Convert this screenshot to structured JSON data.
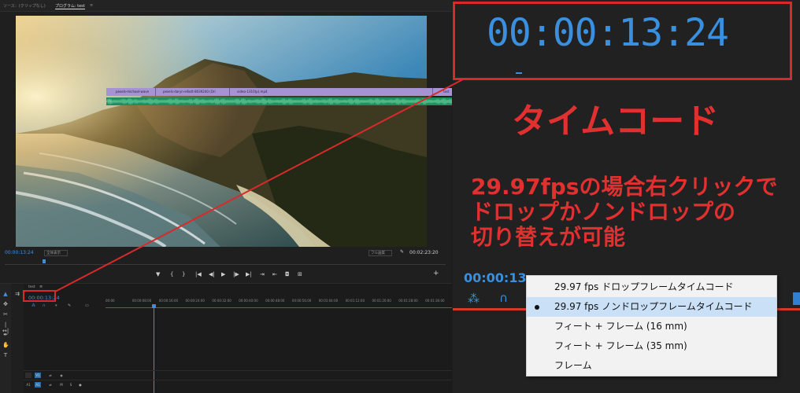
{
  "left_panel": {
    "monitor_header": {
      "source_tab": "ソース：(クリップなし)",
      "program_tab": "プログラム: test",
      "program_menu_icon": "hamburger-icon"
    },
    "player": {
      "current_timecode": "00:00:13:24",
      "fit_label": "全体表示",
      "resolution_label": "フル画質",
      "duration": "00:02:23:20"
    },
    "controls": [
      "marker-icon",
      "in-point-icon",
      "out-point-icon",
      "go-to-in-icon",
      "step-back-icon",
      "play-icon",
      "step-forward-icon",
      "go-to-out-icon",
      "insert-icon",
      "overwrite-icon",
      "export-frame-icon",
      "settings-icon",
      "add-icon"
    ],
    "timeline": {
      "sequence_tab": "test",
      "sequence_timecode": "00:00:13:24",
      "ruler_ticks": [
        "00:00",
        "00:00:08:00",
        "00:00:16:00",
        "00:00:24:00",
        "00:00:32:00",
        "00:00:40:00",
        "00:00:48:00",
        "00:00:56:00",
        "00:01:04:00",
        "00:01:12:00",
        "00:01:20:00",
        "00:01:28:00",
        "00:01:36:00"
      ],
      "tracks": [
        {
          "id": "V1",
          "label": "V1"
        },
        {
          "id": "A1",
          "label": "A1"
        }
      ],
      "video_clips": [
        "pexels-michael-wave",
        "pexels-daryn-elliott-8039240 (Ori",
        "video-1310(p).mp4",
        "test"
      ],
      "audio_clip_label": "fx"
    }
  },
  "zoom_panel": {
    "big_timecode": "00:00:13:24",
    "timecode_label": "タイムコード",
    "description_lines": [
      "29.97fpsの場合右クリックで",
      "ドロップかノンドロップの",
      "切り替えが可能"
    ],
    "timecode_small": "00:00:13:"
  },
  "context_menu": {
    "items": [
      {
        "label": "29.97 fps ドロップフレームタイムコード",
        "selected": false
      },
      {
        "label": "29.97 fps ノンドロップフレームタイムコード",
        "selected": true
      },
      {
        "label": "フィート + フレーム (16 mm)",
        "selected": false
      },
      {
        "label": "フィート + フレーム (35 mm)",
        "selected": false
      },
      {
        "label": "フレーム",
        "selected": false
      }
    ]
  },
  "colors": {
    "annotation_red": "#d82a2a",
    "timecode_blue": "#3a8fde",
    "video_clip_purple": "#a693d3",
    "audio_clip_green": "#1d8f5c",
    "menu_selection": "#c9e0f7"
  }
}
